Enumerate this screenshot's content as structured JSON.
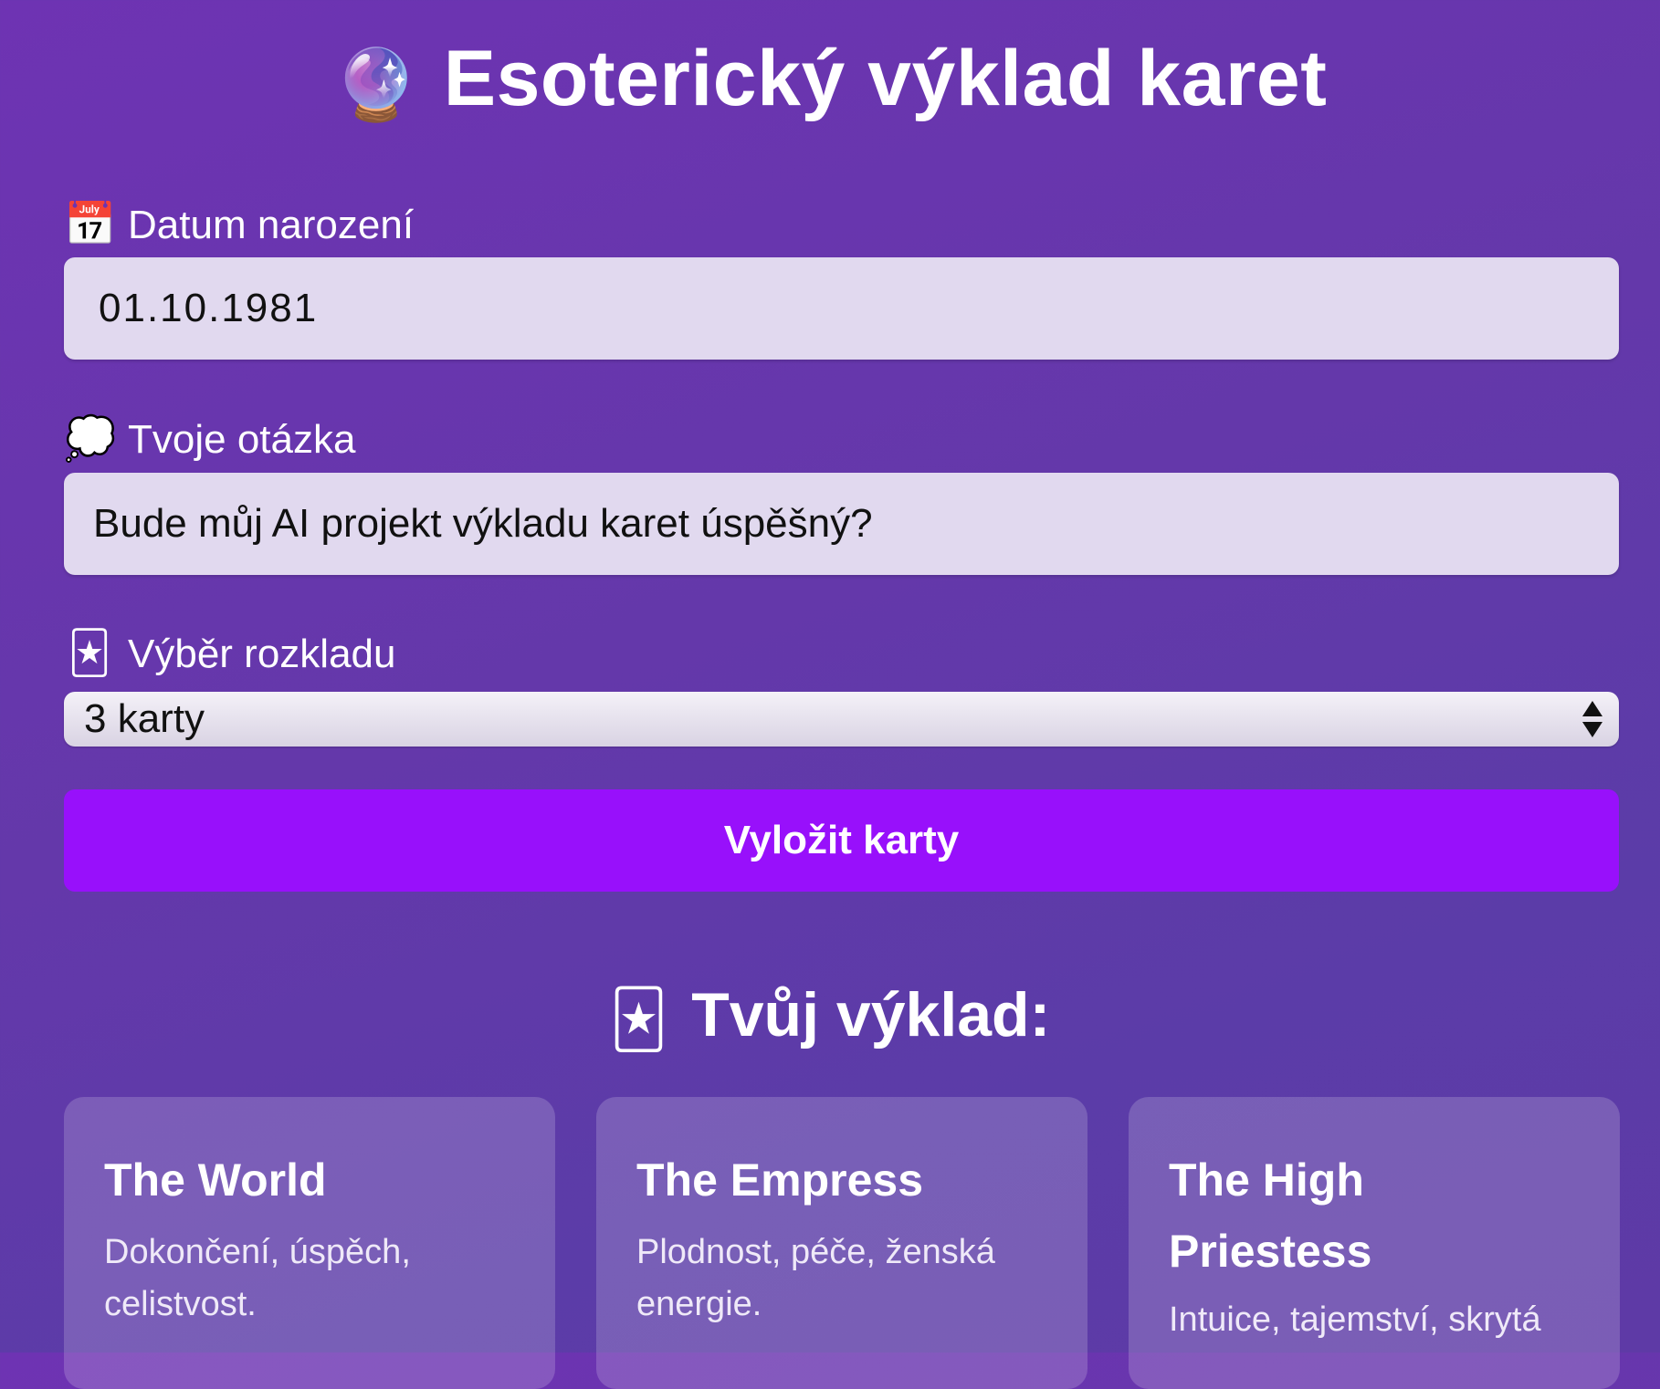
{
  "header": {
    "icon": "crystal-ball-icon",
    "icon_glyph": "🔮",
    "title": "Esoterický výklad karet"
  },
  "form": {
    "birthdate": {
      "icon": "calendar-icon",
      "icon_glyph": "📅",
      "label": "Datum narození",
      "value": "01.10.1981"
    },
    "question": {
      "icon": "thought-balloon-icon",
      "icon_glyph": "💭",
      "label": "Tvoje otázka",
      "value": "Bude můj AI projekt výkladu karet úspěšný?"
    },
    "spread": {
      "icon": "joker-card-icon",
      "icon_glyph": "🃏",
      "label": "Výběr rozkladu",
      "selected": "3 karty"
    },
    "submit_label": "Vyložit karty"
  },
  "reading": {
    "icon": "joker-card-icon",
    "icon_glyph": "🃏",
    "title": "Tvůj výklad:",
    "cards": [
      {
        "name": "The World",
        "meaning": "Dokončení, úspěch, celistvost."
      },
      {
        "name": "The Empress",
        "meaning": "Plodnost, péče, ženská energie."
      },
      {
        "name": "The High Priestess",
        "meaning": "Intuice, tajemství, skrytá"
      }
    ]
  },
  "colors": {
    "background_start": "#6e33b3",
    "background_end": "#5b3ca8",
    "button": "#9810fb",
    "input_background": "#e1d9ef"
  }
}
